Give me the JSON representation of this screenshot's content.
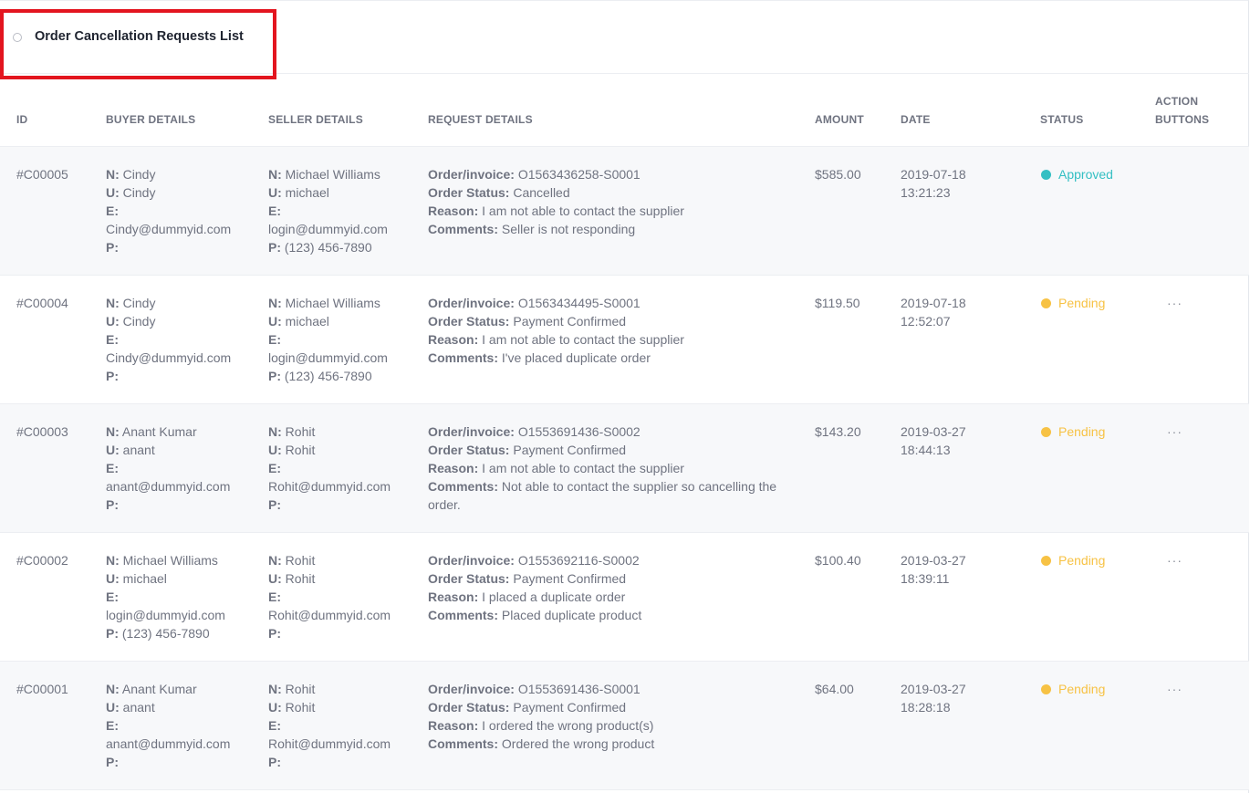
{
  "header": {
    "title": "Order Cancellation Requests List"
  },
  "columns": {
    "id": "ID",
    "buyer": "BUYER DETAILS",
    "seller": "SELLER DETAILS",
    "request": "REQUEST DETAILS",
    "amount": "AMOUNT",
    "date": "DATE",
    "status": "STATUS",
    "action_line1": "ACTION",
    "action_line2": "BUTTONS"
  },
  "labels": {
    "name": "N:",
    "username": "U:",
    "email": "E:",
    "phone": "P:",
    "order": "Order/invoice:",
    "order_status": "Order Status:",
    "reason": "Reason:",
    "comments": "Comments:"
  },
  "status_colors": {
    "approved": "#34bfc3",
    "pending": "#f7c244"
  },
  "icons": {
    "actions": "more-horizontal-icon",
    "title": "circle-outline-icon"
  },
  "rows": [
    {
      "id": "#C00005",
      "buyer": {
        "name": "Cindy",
        "username": "Cindy",
        "email": "Cindy@dummyid.com",
        "phone": ""
      },
      "seller": {
        "name": "Michael Williams",
        "username": "michael",
        "email": "login@dummyid.com",
        "phone": "(123) 456-7890"
      },
      "request": {
        "order": "O1563436258-S0001",
        "order_status": "Cancelled",
        "reason": "I am not able to contact the supplier",
        "comments": "Seller is not responding"
      },
      "amount": "$585.00",
      "date": "2019-07-18",
      "time": "13:21:23",
      "status": "Approved",
      "actions": ""
    },
    {
      "id": "#C00004",
      "buyer": {
        "name": "Cindy",
        "username": "Cindy",
        "email": "Cindy@dummyid.com",
        "phone": ""
      },
      "seller": {
        "name": "Michael Williams",
        "username": "michael",
        "email": "login@dummyid.com",
        "phone": "(123) 456-7890"
      },
      "request": {
        "order": "O1563434495-S0001",
        "order_status": "Payment Confirmed",
        "reason": "I am not able to contact the supplier",
        "comments": "I've placed duplicate order"
      },
      "amount": "$119.50",
      "date": "2019-07-18",
      "time": "12:52:07",
      "status": "Pending",
      "actions": "···"
    },
    {
      "id": "#C00003",
      "buyer": {
        "name": "Anant Kumar",
        "username": "anant",
        "email": "anant@dummyid.com",
        "phone": ""
      },
      "seller": {
        "name": "Rohit",
        "username": "Rohit",
        "email": "Rohit@dummyid.com",
        "phone": ""
      },
      "request": {
        "order": "O1553691436-S0002",
        "order_status": "Payment Confirmed",
        "reason": "I am not able to contact the supplier",
        "comments": "Not able to contact the supplier so cancelling the order."
      },
      "amount": "$143.20",
      "date": "2019-03-27",
      "time": "18:44:13",
      "status": "Pending",
      "actions": "···"
    },
    {
      "id": "#C00002",
      "buyer": {
        "name": "Michael Williams",
        "username": "michael",
        "email": "login@dummyid.com",
        "phone": "(123) 456-7890"
      },
      "seller": {
        "name": "Rohit",
        "username": "Rohit",
        "email": "Rohit@dummyid.com",
        "phone": ""
      },
      "request": {
        "order": "O1553692116-S0002",
        "order_status": "Payment Confirmed",
        "reason": "I placed a duplicate order",
        "comments": "Placed duplicate product"
      },
      "amount": "$100.40",
      "date": "2019-03-27",
      "time": "18:39:11",
      "status": "Pending",
      "actions": "···"
    },
    {
      "id": "#C00001",
      "buyer": {
        "name": "Anant Kumar",
        "username": "anant",
        "email": "anant@dummyid.com",
        "phone": ""
      },
      "seller": {
        "name": "Rohit",
        "username": "Rohit",
        "email": "Rohit@dummyid.com",
        "phone": ""
      },
      "request": {
        "order": "O1553691436-S0001",
        "order_status": "Payment Confirmed",
        "reason": "I ordered the wrong product(s)",
        "comments": "Ordered the wrong product"
      },
      "amount": "$64.00",
      "date": "2019-03-27",
      "time": "18:28:18",
      "status": "Pending",
      "actions": "···"
    }
  ]
}
